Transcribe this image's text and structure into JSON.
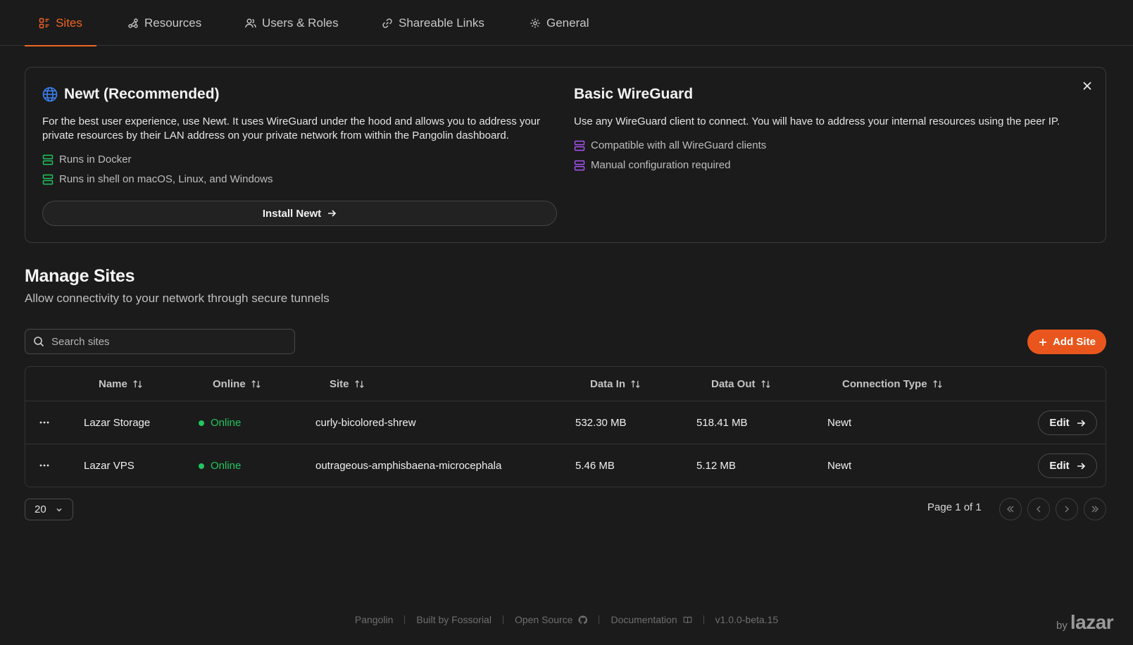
{
  "tabs": [
    {
      "label": "Sites",
      "icon": "sites-icon",
      "active": true
    },
    {
      "label": "Resources",
      "icon": "resources-icon",
      "active": false
    },
    {
      "label": "Users & Roles",
      "icon": "users-icon",
      "active": false
    },
    {
      "label": "Shareable Links",
      "icon": "link-icon",
      "active": false
    },
    {
      "label": "General",
      "icon": "gear-icon",
      "active": false
    }
  ],
  "info_card": {
    "newt": {
      "title": "Newt (Recommended)",
      "description": "For the best user experience, use Newt. It uses WireGuard under the hood and allows you to address your private resources by their LAN address on your private network from within the Pangolin dashboard.",
      "features": [
        "Runs in Docker",
        "Runs in shell on macOS, Linux, and Windows"
      ],
      "button": "Install Newt"
    },
    "wireguard": {
      "title": "Basic WireGuard",
      "description": "Use any WireGuard client to connect. You will have to address your internal resources using the peer IP.",
      "features": [
        "Compatible with all WireGuard clients",
        "Manual configuration required"
      ]
    }
  },
  "manage": {
    "title": "Manage Sites",
    "subtitle": "Allow connectivity to your network through secure tunnels",
    "search_placeholder": "Search sites",
    "add_button": "Add Site"
  },
  "table": {
    "columns": [
      "Name",
      "Online",
      "Site",
      "Data In",
      "Data Out",
      "Connection Type"
    ],
    "rows": [
      {
        "name": "Lazar Storage",
        "online": "Online",
        "site": "curly-bicolored-shrew",
        "data_in": "532.30 MB",
        "data_out": "518.41 MB",
        "connection": "Newt",
        "action": "Edit"
      },
      {
        "name": "Lazar VPS",
        "online": "Online",
        "site": "outrageous-amphisbaena-microcephala",
        "data_in": "5.46 MB",
        "data_out": "5.12 MB",
        "connection": "Newt",
        "action": "Edit"
      }
    ]
  },
  "pagination": {
    "page_size": "20",
    "page_info": "Page 1 of 1"
  },
  "footer": {
    "items": [
      "Pangolin",
      "Built by Fossorial",
      "Open Source",
      "Documentation",
      "v1.0.0-beta.15"
    ],
    "brand_prefix": "by",
    "brand": "lazar"
  },
  "colors": {
    "accent": "#f26522",
    "online": "#22c55e",
    "newt_feature": "#22c55e",
    "wireguard_feature": "#a855f7",
    "newt_globe": "#3b82f6"
  }
}
